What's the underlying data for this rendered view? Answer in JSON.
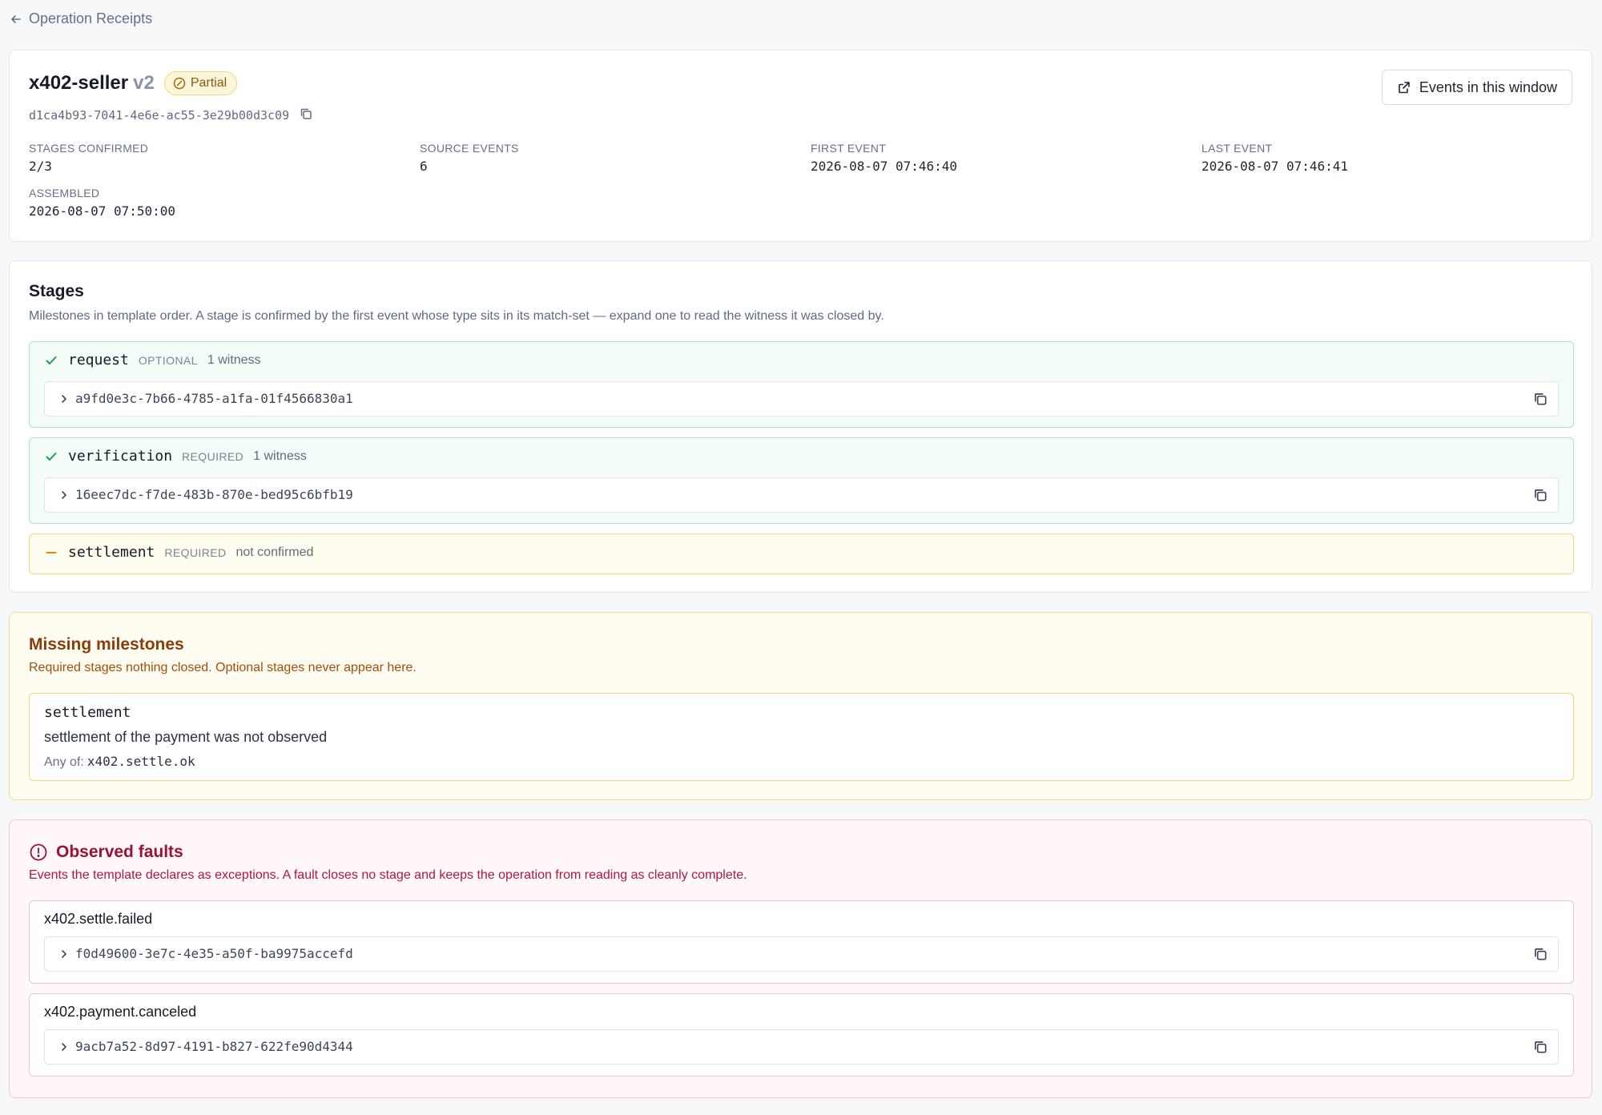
{
  "nav": {
    "back_label": "Operation Receipts"
  },
  "header": {
    "title": "x402-seller",
    "version": "v2",
    "status_badge": "Partial",
    "operation_id": "d1ca4b93-7041-4e6e-ac55-3e29b00d3c09",
    "events_button": "Events in this window",
    "stats": [
      {
        "label": "Stages confirmed",
        "value": "2/3"
      },
      {
        "label": "Source events",
        "value": "6"
      },
      {
        "label": "First event",
        "value": "2026-08-07 07:46:40"
      },
      {
        "label": "Last event",
        "value": "2026-08-07 07:46:41"
      },
      {
        "label": "Assembled",
        "value": "2026-08-07 07:50:00"
      }
    ]
  },
  "stages": {
    "title": "Stages",
    "description": "Milestones in template order. A stage is confirmed by the first event whose type sits in its match-set — expand one to read the witness it was closed by.",
    "items": [
      {
        "name": "request",
        "requirement": "Optional",
        "meta": "1 witness",
        "status": "confirmed",
        "witness_id": "a9fd0e3c-7b66-4785-a1fa-01f4566830a1"
      },
      {
        "name": "verification",
        "requirement": "Required",
        "meta": "1 witness",
        "status": "confirmed",
        "witness_id": "16eec7dc-f7de-483b-870e-bed95c6bfb19"
      },
      {
        "name": "settlement",
        "requirement": "Required",
        "meta": "not confirmed",
        "status": "missing"
      }
    ]
  },
  "missing": {
    "title": "Missing milestones",
    "description": "Required stages nothing closed. Optional stages never appear here.",
    "items": [
      {
        "name": "settlement",
        "text": "settlement of the payment was not observed",
        "any_of_label": "Any of:",
        "any_of_value": "x402.settle.ok"
      }
    ]
  },
  "faults": {
    "title": "Observed faults",
    "description": "Events the template declares as exceptions. A fault closes no stage and keeps the operation from reading as cleanly complete.",
    "items": [
      {
        "type": "x402.settle.failed",
        "event_id": "f0d49600-3e7c-4e35-a50f-ba9975accefd"
      },
      {
        "type": "x402.payment.canceled",
        "event_id": "9acb7a52-8d97-4191-b827-622fe90d4344"
      }
    ]
  },
  "colors": {
    "confirmed": "#16a34a",
    "missing": "#e8890c",
    "fault": "#c0143c",
    "badge_partial": "#fef6dc"
  },
  "icons": [
    "arrow-left-icon",
    "partial-circle-icon",
    "copy-icon",
    "external-link-icon",
    "check-icon",
    "dash-icon",
    "chevron-right-icon",
    "alert-circle-icon"
  ]
}
